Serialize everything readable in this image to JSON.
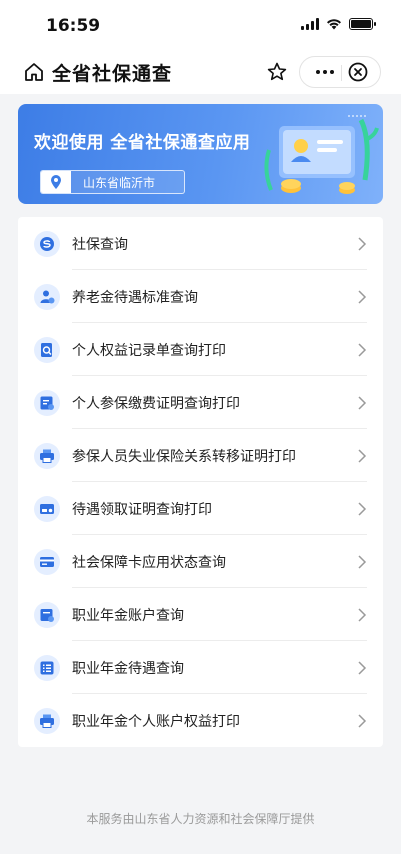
{
  "status_bar": {
    "time": "16:59"
  },
  "nav": {
    "title": "全省社保通查"
  },
  "banner": {
    "title": "欢迎使用 全省社保通查应用",
    "location": "山东省临沂市"
  },
  "menu": [
    {
      "label": "社保查询",
      "icon": "social-security-icon"
    },
    {
      "label": "养老金待遇标准查询",
      "icon": "pension-user-icon"
    },
    {
      "label": "个人权益记录单查询打印",
      "icon": "record-search-icon"
    },
    {
      "label": "个人参保缴费证明查询打印",
      "icon": "payment-certificate-icon"
    },
    {
      "label": "参保人员失业保险关系转移证明打印",
      "icon": "printer-icon"
    },
    {
      "label": "待遇领取证明查询打印",
      "icon": "benefit-card-icon"
    },
    {
      "label": "社会保障卡应用状态查询",
      "icon": "card-icon"
    },
    {
      "label": "职业年金账户查询",
      "icon": "annuity-account-icon"
    },
    {
      "label": "职业年金待遇查询",
      "icon": "annuity-list-icon"
    },
    {
      "label": "职业年金个人账户权益打印",
      "icon": "printer-icon"
    }
  ],
  "footer": {
    "text": "本服务由山东省人力资源和社会保障厅提供"
  },
  "colors": {
    "accent": "#3d7de6",
    "icon_bg": "#e4eeff",
    "icon_fg": "#2f6fe0",
    "page_bg": "#f3f4f6"
  }
}
